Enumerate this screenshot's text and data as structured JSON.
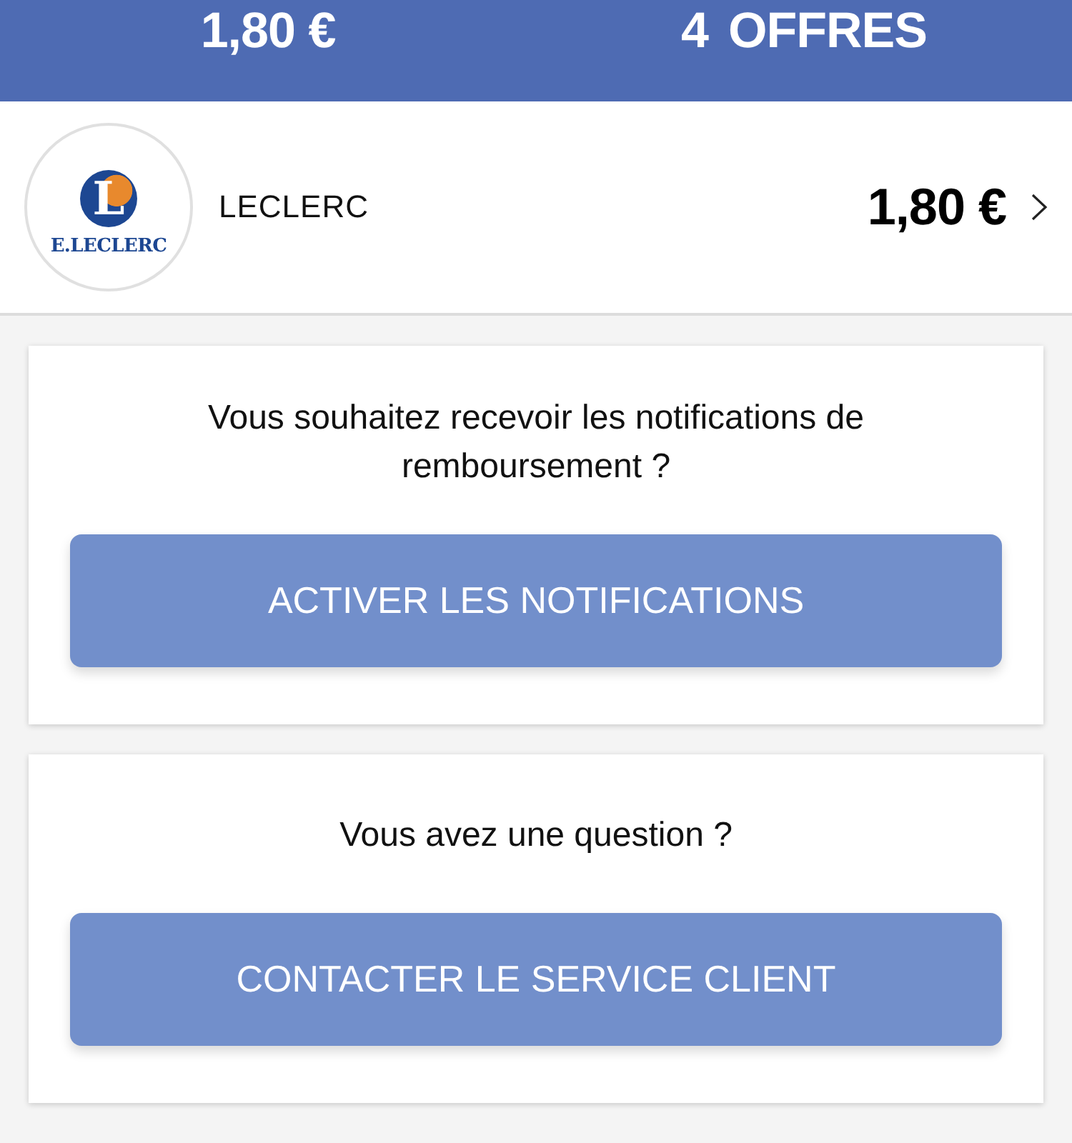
{
  "summary_bar": {
    "amount": "1,80 €",
    "offers_count": "4",
    "offers_label": "OFFRES"
  },
  "store": {
    "logo_letter": "L",
    "logo_text": "E.LECLERC",
    "name": "LECLERC",
    "amount": "1,80 €"
  },
  "cards": [
    {
      "message": "Vous souhaitez recevoir les notifications de remboursement ?",
      "button": "ACTIVER LES NOTIFICATIONS"
    },
    {
      "message": "Vous avez une question ?",
      "button": "CONTACTER LE SERVICE CLIENT"
    }
  ]
}
